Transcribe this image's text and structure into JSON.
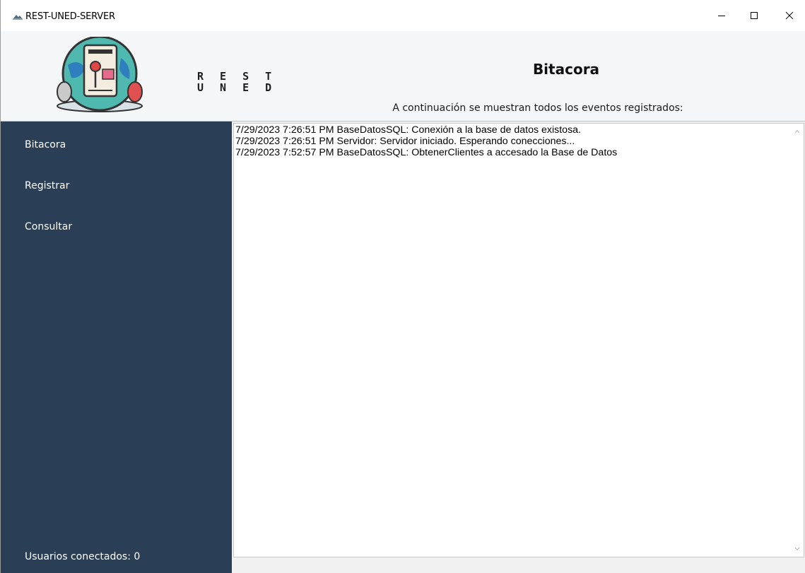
{
  "window": {
    "title": "REST-UNED-SERVER"
  },
  "header": {
    "logo_line1": "R E S T",
    "logo_line2": "U N E D",
    "title": "Bitacora",
    "subtitle": "A continuación se muestran todos los eventos registrados:"
  },
  "sidebar": {
    "items": [
      {
        "label": "Bitacora"
      },
      {
        "label": "Registrar"
      },
      {
        "label": "Consultar"
      }
    ],
    "status": "Usuarios conectados: 0"
  },
  "log": {
    "lines": [
      "7/29/2023 7:26:51 PM BaseDatosSQL: Conexión a la base de datos existosa.",
      "7/29/2023 7:26:51 PM Servidor: Servidor iniciado. Esperando conecciones...",
      "7/29/2023 7:52:57 PM BaseDatosSQL: ObtenerClientes a accesado la Base de Datos"
    ]
  },
  "colors": {
    "sidebar_bg": "#2a3f55",
    "header_bg": "#f4f6f8",
    "log_bg": "#ffffff"
  }
}
